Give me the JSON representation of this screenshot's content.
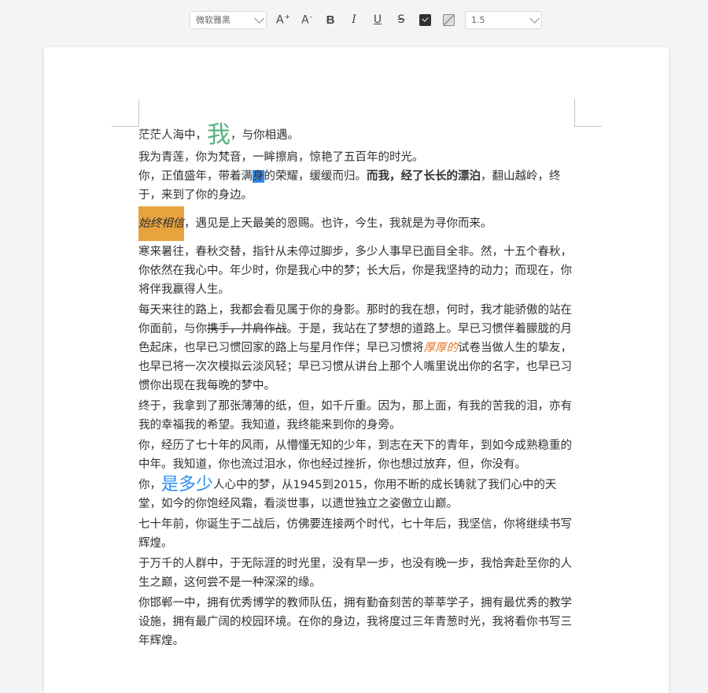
{
  "toolbar": {
    "font_family": "微软雅黑",
    "font_increase_label": "A",
    "font_increase_sup": "+",
    "font_decrease_label": "A",
    "font_decrease_sup": "-",
    "bold_label": "B",
    "italic_label": "I",
    "underline_label": "U",
    "strike_label": "S",
    "line_height": "1.5",
    "text_color": "#303133"
  },
  "doc": {
    "p1": {
      "a": "茫茫人海中，",
      "big": "我",
      "b": "，与你相遇。"
    },
    "p2": "我为青莲，你为梵音，一眸擦肩，惊艳了五百年的时光。",
    "p3": {
      "a": "你，正值盛年，带着满",
      "sel": "身",
      "b": "的荣耀，缓缓而归。",
      "bold": "而我，经了长长的漂泊",
      "c": "，翻山越岭，终于，来到了你的身边。"
    },
    "p4": {
      "hl": "始终相信",
      "a": "，遇见是上天最美的恩赐。也许，今生，我就是为寻你而来。"
    },
    "p5": "寒来暑往，春秋交替，指针从未停过脚步，多少人事早已面目全非。然，十五个春秋，你依然在我心中。年少时，你是我心中的梦；长大后，你是我坚持的动力；而现在，你将伴我赢得人生。",
    "p6": {
      "a": "每天来往的路上，我都会看见属于你的身影。那时的我在想，何时，我才能骄傲的站在你面前，与你",
      "strike": "携手，并肩作战",
      "b": "。于是，我站在了梦想的道路上。早已习惯伴着朦胧的月色起床，也早已习惯回家的路上与星月作伴；早已习惯将",
      "orange": "厚厚的",
      "c": "试卷当做人生的挚友，也早已将一次次模拟云淡风轻；早已习惯从讲台上那个人嘴里说出你的名字，也早已习惯你出现在我每晚的梦中。"
    },
    "p7": "终于，我拿到了那张薄薄的纸，但，如千斤重。因为，那上面，有我的苦我的泪，亦有我的幸福我的希望。我知道，我终能来到你的身旁。",
    "p8": "你，经历了七十年的风雨，从懵懂无知的少年，到志在天下的青年，到如今成熟稳重的中年。我知道，你也流过泪水，你也经过挫折，你也想过放弃，但，你没有。",
    "p9": {
      "a": "你，",
      "big": "是多少",
      "b": "人心中的梦，从1945到2015，你用不断的成长铸就了我们心中的天堂，如今的你饱经风霜，看淡世事，以遗世独立之姿傲立山巅。"
    },
    "p10": "七十年前，你诞生于二战后，仿佛要连接两个时代，七十年后，我坚信，你将继续书写辉煌。",
    "p11": "于万千的人群中，于无际涯的时光里，没有早一步，也没有晚一步，我恰奔赴至你的人生之巅，这何尝不是一种深深的缘。",
    "p12": "你邯郸一中，拥有优秀博学的教师队伍，拥有勤奋刻苦的莘莘学子，拥有最优秀的教学设施，拥有最广阔的校园环境。在你的身边，我将度过三年青葱时光，我将看你书写三年辉煌。"
  }
}
